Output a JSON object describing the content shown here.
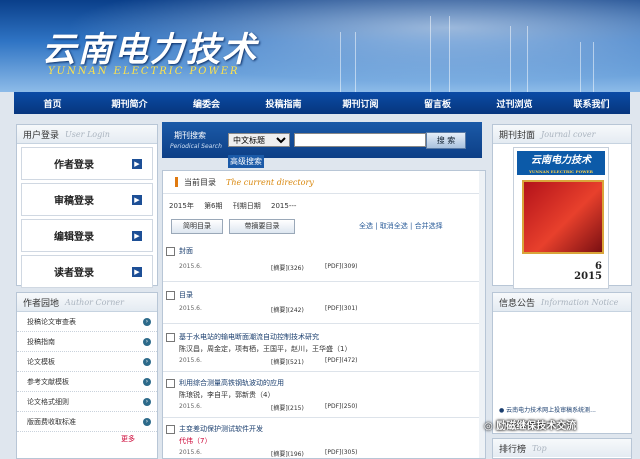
{
  "site": {
    "title_cn": "云南电力技术",
    "title_en": "YUNNAN ELECTRIC POWER"
  },
  "nav": [
    "首页",
    "期刊简介",
    "编委会",
    "投稿指南",
    "期刊订阅",
    "留言板",
    "过刊浏览",
    "联系我们"
  ],
  "login": {
    "title": "用户登录",
    "title_en": "User Login",
    "items": [
      "作者登录",
      "审稿登录",
      "编辑登录",
      "读者登录"
    ]
  },
  "author": {
    "title": "作者园地",
    "title_en": "Author Corner",
    "items": [
      "投稿论文审查表",
      "投稿指南",
      "论文模板",
      "参考文献模板",
      "论文格式细则",
      "版面费收取标准"
    ],
    "more": "更多"
  },
  "search": {
    "label": "期刊搜索",
    "label_en": "Periodical Search",
    "selected": "中文标题",
    "button": "搜 索",
    "advanced": "高级搜索"
  },
  "directory": {
    "title": "当前目录",
    "title_en": "The current directory",
    "year": "2015年",
    "issue": "第6期",
    "date_label": "刊期日期",
    "date_value": "2015---",
    "tab_simple": "简明目录",
    "tab_abstract": "带摘要目录",
    "op_all": "全选",
    "op_cancel": "取消全选",
    "op_merge": "合并选择"
  },
  "articles": [
    {
      "title": "封面",
      "authors": "",
      "date": "2015.6.",
      "abs": "[摘要](326)",
      "pdf": "[PDF](309)"
    },
    {
      "title": "目录",
      "authors": "",
      "date": "2015.6.",
      "abs": "[摘要](242)",
      "pdf": "[PDF](301)"
    },
    {
      "title": "基于水电站的输电断面潮流自动控制技术研究",
      "authors": "陈汉昌，周金定，项有栖，王国平，赵川，王华盛（1）",
      "date": "2015.6.",
      "abs": "[摘要](521)",
      "pdf": "[PDF](472)"
    },
    {
      "title": "利用综合测量高铁钢轨波动的应用",
      "authors": "陈琅锐，李自平，郭新贵（4）",
      "date": "2015.6.",
      "abs": "[摘要](215)",
      "pdf": "[PDF](250)"
    },
    {
      "title": "主变差动保护测试软件开发",
      "authors": "代伟（7）",
      "date": "2015.6.",
      "abs": "[摘要](196)",
      "pdf": "[PDF](305)"
    }
  ],
  "cover": {
    "title": "期刊封面",
    "title_en": "Journal cover",
    "mag_cn": "云南电力技术",
    "mag_en": "YUNNAN ELECTRIC POWER",
    "issue_no": "6",
    "issue_year": "2015"
  },
  "notice": {
    "title": "信息公告",
    "title_en": "Information Notice",
    "item": "云南电力技术网上投审稿系统测..."
  },
  "ranking": {
    "title": "排行榜",
    "title_en": "Top"
  },
  "watermark": "励磁继保技术交流"
}
